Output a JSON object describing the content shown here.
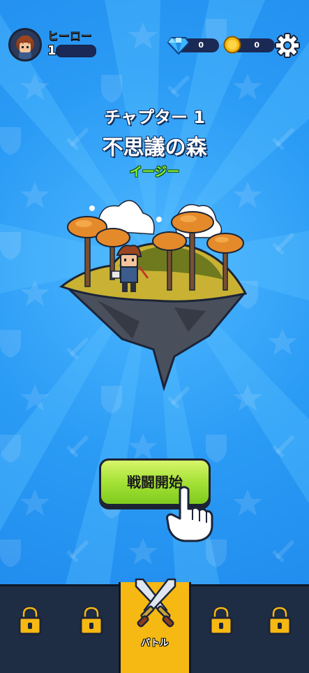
{
  "header": {
    "hero_name": "ヒーロー",
    "level": "1",
    "gems": "0",
    "coins": "0"
  },
  "stage": {
    "chapter": "チャプター 1",
    "name": "不思議の森",
    "difficulty": "イージー"
  },
  "start_button": {
    "label": "戦闘開始"
  },
  "nav": {
    "battle_label": "バトル",
    "icons": [
      "lock-icon",
      "lock-icon",
      "crossed-swords-icon",
      "lock-icon",
      "lock-icon"
    ]
  },
  "colors": {
    "background": "#2a9bf5",
    "difficulty": "#7ff23c",
    "button": "#a9e43a",
    "nav": "#1e2c44",
    "nav_active": "#f6b813"
  }
}
